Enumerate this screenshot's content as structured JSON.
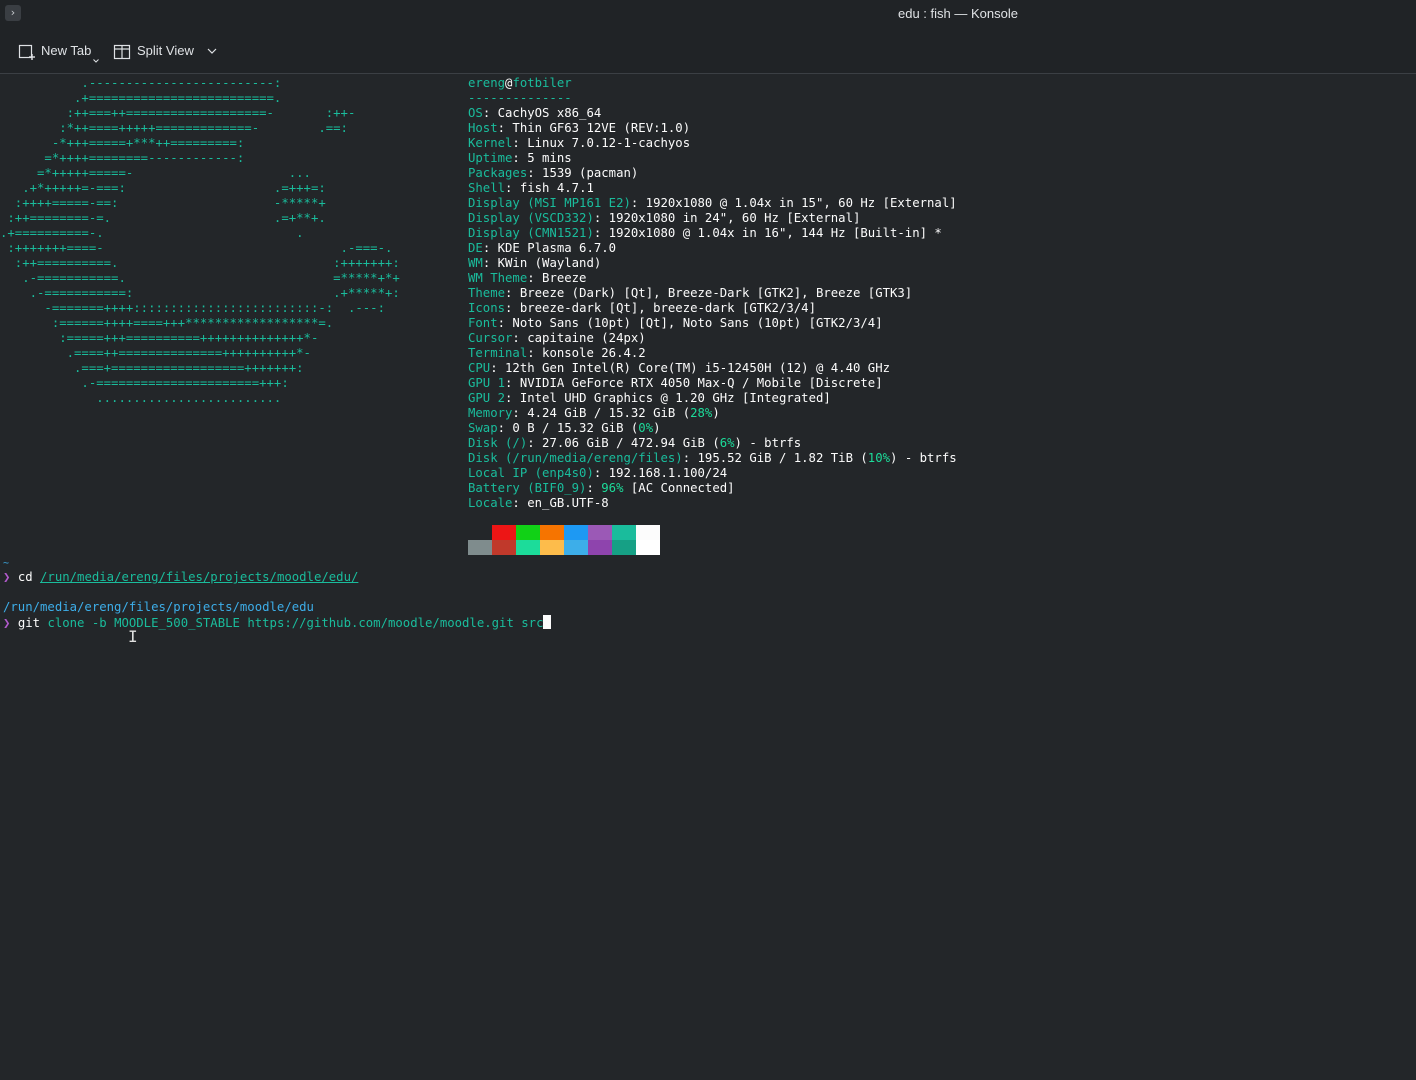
{
  "window": {
    "title": "edu : fish — Konsole",
    "menu_icon_glyph": "›"
  },
  "toolbar": {
    "new_tab_label": "New Tab",
    "split_view_label": "Split View"
  },
  "fastfetch": {
    "logo_lines": [
      "           .-------------------------:",
      "          .+=========================.",
      "         :++===++===================-       :++-",
      "        :*++====+++++=============-        .==:",
      "       -*+++=====+***++=========:",
      "      =*++++========------------:",
      "     =*+++++=====-                     ...",
      "   .+*+++++=-===:                    .=+++=:",
      "  :++++=====-==:                     -*****+",
      " :++========-=.                      .=+**+.",
      ".+==========-.                          .",
      " :+++++++====-                                .-===-.",
      "  :++==========.                             :+++++++:",
      "   .-===========.                            =*****+*+",
      "    .-===========:                           .+*****+:",
      "      -=======++++:::::::::::::::::::::::::-:  .---:",
      "       :======++++====+++******************=.",
      "        :=====+++==========++++++++++++++*-",
      "         .====++==============++++++++++*-",
      "          .===+==================+++++++:",
      "           .-======================+++:",
      "             ........................."
    ],
    "user": "ereng",
    "at": "@",
    "host": "fotbiler",
    "separator": "--------------",
    "info": [
      {
        "key": "OS",
        "value": "CachyOS x86_64"
      },
      {
        "key": "Host",
        "value": "Thin GF63 12VE (REV:1.0)"
      },
      {
        "key": "Kernel",
        "value": "Linux 7.0.12-1-cachyos"
      },
      {
        "key": "Uptime",
        "value": "5 mins"
      },
      {
        "key": "Packages",
        "value": "1539 (pacman)"
      },
      {
        "key": "Shell",
        "value": "fish 4.7.1"
      },
      {
        "key": "Display (MSI MP161 E2)",
        "value": "1920x1080 @ 1.04x in 15\", 60 Hz [External]"
      },
      {
        "key": "Display (VSCD332)",
        "value": "1920x1080 in 24\", 60 Hz [External]"
      },
      {
        "key": "Display (CMN1521)",
        "value": "1920x1080 @ 1.04x in 16\", 144 Hz [Built-in] *"
      },
      {
        "key": "DE",
        "value": "KDE Plasma 6.7.0"
      },
      {
        "key": "WM",
        "value": "KWin (Wayland)"
      },
      {
        "key": "WM Theme",
        "value": "Breeze"
      },
      {
        "key": "Theme",
        "value": "Breeze (Dark) [Qt], Breeze-Dark [GTK2], Breeze [GTK3]"
      },
      {
        "key": "Icons",
        "value": "breeze-dark [Qt], breeze-dark [GTK2/3/4]"
      },
      {
        "key": "Font",
        "value": "Noto Sans (10pt) [Qt], Noto Sans (10pt) [GTK2/3/4]"
      },
      {
        "key": "Cursor",
        "value": "capitaine (24px)"
      },
      {
        "key": "Terminal",
        "value": "konsole 26.4.2"
      },
      {
        "key": "CPU",
        "value": "12th Gen Intel(R) Core(TM) i5-12450H (12) @ 4.40 GHz"
      },
      {
        "key": "GPU 1",
        "value": "NVIDIA GeForce RTX 4050 Max-Q / Mobile [Discrete]"
      },
      {
        "key": "GPU 2",
        "value": "Intel UHD Graphics @ 1.20 GHz [Integrated]"
      }
    ],
    "memory": {
      "key": "Memory",
      "pre": "4.24 GiB / 15.32 GiB (",
      "pct": "28%",
      "post": ")"
    },
    "swap": {
      "key": "Swap",
      "pre": "0 B / 15.32 GiB (",
      "pct": "0%",
      "post": ")"
    },
    "disk_root": {
      "key": "Disk (/)",
      "pre": "27.06 GiB / 472.94 GiB (",
      "pct": "6%",
      "post": ") - btrfs"
    },
    "disk_files": {
      "key": "Disk (/run/media/ereng/files)",
      "pre": "195.52 GiB / 1.82 TiB (",
      "pct": "10%",
      "post": ") - btrfs"
    },
    "local_ip": {
      "key": "Local IP (enp4s0)",
      "value": "192.168.1.100/24"
    },
    "battery": {
      "key": "Battery (BIF0_9)",
      "pct": "96%",
      "post": " [AC Connected]"
    },
    "locale": {
      "key": "Locale",
      "value": "en_GB.UTF-8"
    },
    "palette_top": [
      "#232629",
      "#ed1515",
      "#11d116",
      "#f67400",
      "#1d99f3",
      "#9b59b6",
      "#1abc9c",
      "#fcfcfc"
    ],
    "palette_bottom": [
      "#7f8c8d",
      "#c0392b",
      "#1cdc9a",
      "#fdbc4b",
      "#3daee9",
      "#8e44ad",
      "#16a085",
      "#ffffff"
    ]
  },
  "shell": {
    "home_marker": "~",
    "prompt_char": "❯",
    "cmd1": "cd",
    "cmd1_arg": "/run/media/ereng/files/projects/moodle/edu/",
    "cwd": "/run/media/ereng/files/projects/moodle/edu",
    "cmd2": "git",
    "cmd2_args": "clone -b MOODLE_500_STABLE https://github.com/moodle/moodle.git",
    "cmd2_last": "src",
    "mouse_cursor_glyph": "I"
  }
}
